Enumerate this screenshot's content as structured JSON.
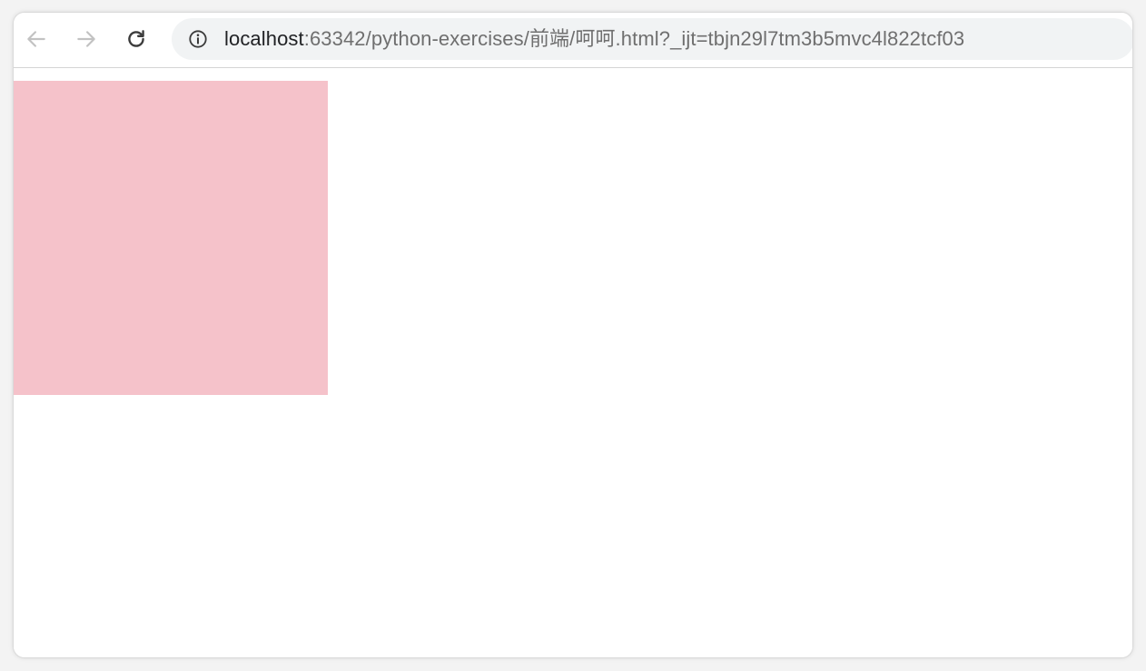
{
  "browser": {
    "address_bar": {
      "host": "localhost",
      "path": ":63342/python-exercises/前端/呵呵.html?_ijt=tbjn29l7tm3b5mvc4l822tcf03"
    },
    "icons": {
      "back": "arrow-left-icon",
      "forward": "arrow-right-icon",
      "reload": "reload-icon",
      "site_info": "info-icon"
    }
  },
  "page": {
    "box_color": "#f5c2ca",
    "background": "#ffffff"
  }
}
